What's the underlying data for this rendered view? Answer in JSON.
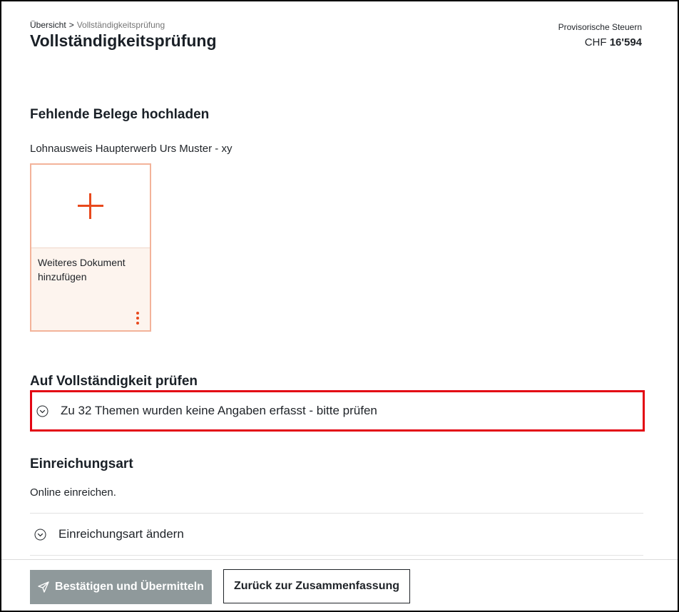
{
  "breadcrumb": {
    "root": "Übersicht",
    "separator": ">",
    "current": "Vollständigkeitsprüfung"
  },
  "page": {
    "title": "Vollständigkeitsprüfung"
  },
  "tax": {
    "label": "Provisorische Steuern",
    "currency": "CHF",
    "amount": "16'594"
  },
  "upload": {
    "heading": "Fehlende Belege hochladen",
    "document_label": "Lohnausweis Haupterwerb Urs Muster - xy",
    "card_label": "Weiteres Dokument hinzufügen",
    "add_icon": "plus-icon",
    "more_icon": "more-vertical-icon"
  },
  "check": {
    "heading": "Auf Vollständigkeit prüfen",
    "accordion_label": "Zu 32 Themen wurden keine Angaben erfasst - bitte prüfen"
  },
  "submission": {
    "heading": "Einreichungsart",
    "value": "Online einreichen.",
    "change_label": "Einreichungsart ändern"
  },
  "footer": {
    "confirm_label": "Bestätigen und Übermitteln",
    "back_label": "Zurück zur Zusammenfassung"
  },
  "colors": {
    "accent": "#e8491d",
    "highlight": "#e30613",
    "primary_button": "#8f999b",
    "card_border": "#f3b39a"
  }
}
